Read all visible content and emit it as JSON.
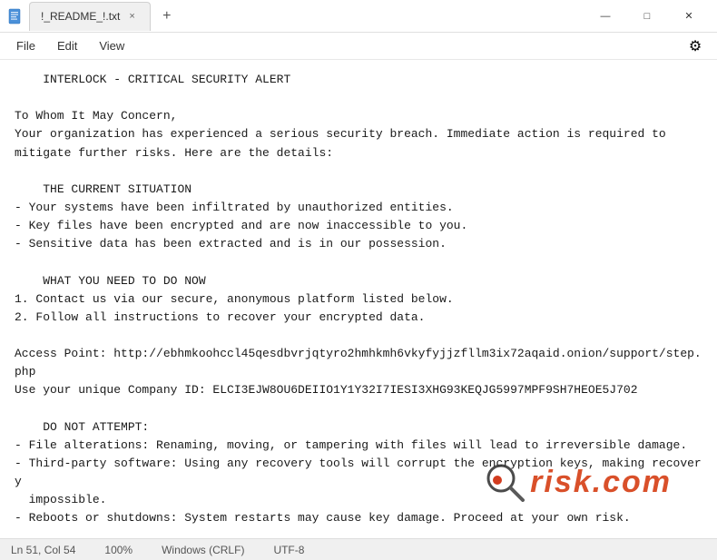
{
  "titlebar": {
    "icon": "📄",
    "tab_label": "!_README_!.txt",
    "close_tab": "×",
    "new_tab": "+",
    "minimize": "—",
    "maximize": "□",
    "close_window": "✕"
  },
  "menubar": {
    "file": "File",
    "edit": "Edit",
    "view": "View",
    "settings_icon": "⚙"
  },
  "editor": {
    "content": "    INTERLOCK - CRITICAL SECURITY ALERT\n\nTo Whom It May Concern,\nYour organization has experienced a serious security breach. Immediate action is required to\nmitigate further risks. Here are the details:\n\n    THE CURRENT SITUATION\n- Your systems have been infiltrated by unauthorized entities.\n- Key files have been encrypted and are now inaccessible to you.\n- Sensitive data has been extracted and is in our possession.\n\n    WHAT YOU NEED TO DO NOW\n1. Contact us via our secure, anonymous platform listed below.\n2. Follow all instructions to recover your encrypted data.\n\nAccess Point: http://ebhmkoohccl45qesdbvrjqtyro2hmhkmh6vkyfyjjzfllm3ix72aqaid.onion/support/step.php\nUse your unique Company ID: ELCI3EJW8OU6DEIIO1Y1Y32I7IESI3XHG93KEQJG5997MPF9SH7HEOE5J702\n\n    DO NOT ATTEMPT:\n- File alterations: Renaming, moving, or tampering with files will lead to irreversible damage.\n- Third-party software: Using any recovery tools will corrupt the encryption keys, making recovery\n  impossible.\n- Reboots or shutdowns: System restarts may cause key damage. Proceed at your own risk.\n\n    HOW DID THIS HAPPEN?\nWe identified vulnerabilities within your network and gained access to critical parts of your\ninfrastructure. The following data categories have been extracted and are now at risk:\n- Personal records and client information\n- Financial statements, contracts, and legal documents\n- Internal communications\n- Backups and business-critical files"
  },
  "statusbar": {
    "position": "Ln 51, Col 54",
    "zoom": "100%",
    "line_ending": "Windows (CRLF)",
    "encoding": "UTF-8"
  },
  "watermark": {
    "text": "risk",
    "tld": ".com"
  }
}
